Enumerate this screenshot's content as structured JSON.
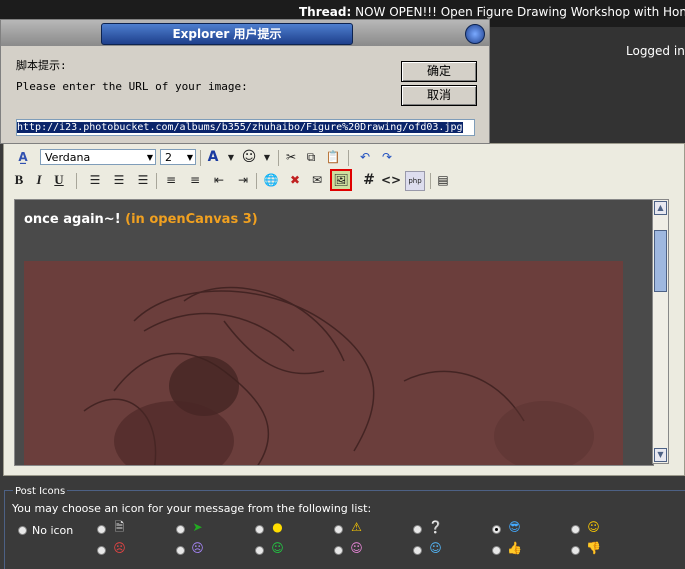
{
  "topbar": {
    "thread_label": "Thread:",
    "thread_title": "NOW OPEN!!! Open Figure Drawing Workshop with Hong L",
    "logged_in": "Logged in"
  },
  "dialog": {
    "title": "Explorer 用户提示",
    "script_prompt": "脚本提示:",
    "message": "Please enter the URL of your image:",
    "ok_label": "确定",
    "cancel_label": "取消",
    "url_value": "http://i23.photobucket.com/albums/b355/zhuhaibo/Figure%20Drawing/ofd03.jpg"
  },
  "toolbar": {
    "font": "Verdana",
    "size": "2",
    "font_color_glyph": "A"
  },
  "editor": {
    "text_main": "once again~!",
    "text_accent": "(in openCanvas 3)"
  },
  "post_icons": {
    "legend": "Post Icons",
    "description": "You may choose an icon for your message from the following list:",
    "no_icon_label": "No icon",
    "icons_row1": [
      "document-icon",
      "arrow-right-icon",
      "lightbulb-icon",
      "warning-icon",
      "question-icon",
      "cool-icon",
      "smile-icon"
    ],
    "icons_row2": [
      "angry-icon",
      "frown-icon",
      "grin-icon",
      "tongue-icon",
      "wink-icon",
      "thumbs-up-icon",
      "thumbs-down-icon"
    ],
    "selected": "cool-icon"
  },
  "colors": {
    "accent": "#f0a020",
    "title_blue": "#1e3f8c",
    "highlight": "#e00000"
  }
}
